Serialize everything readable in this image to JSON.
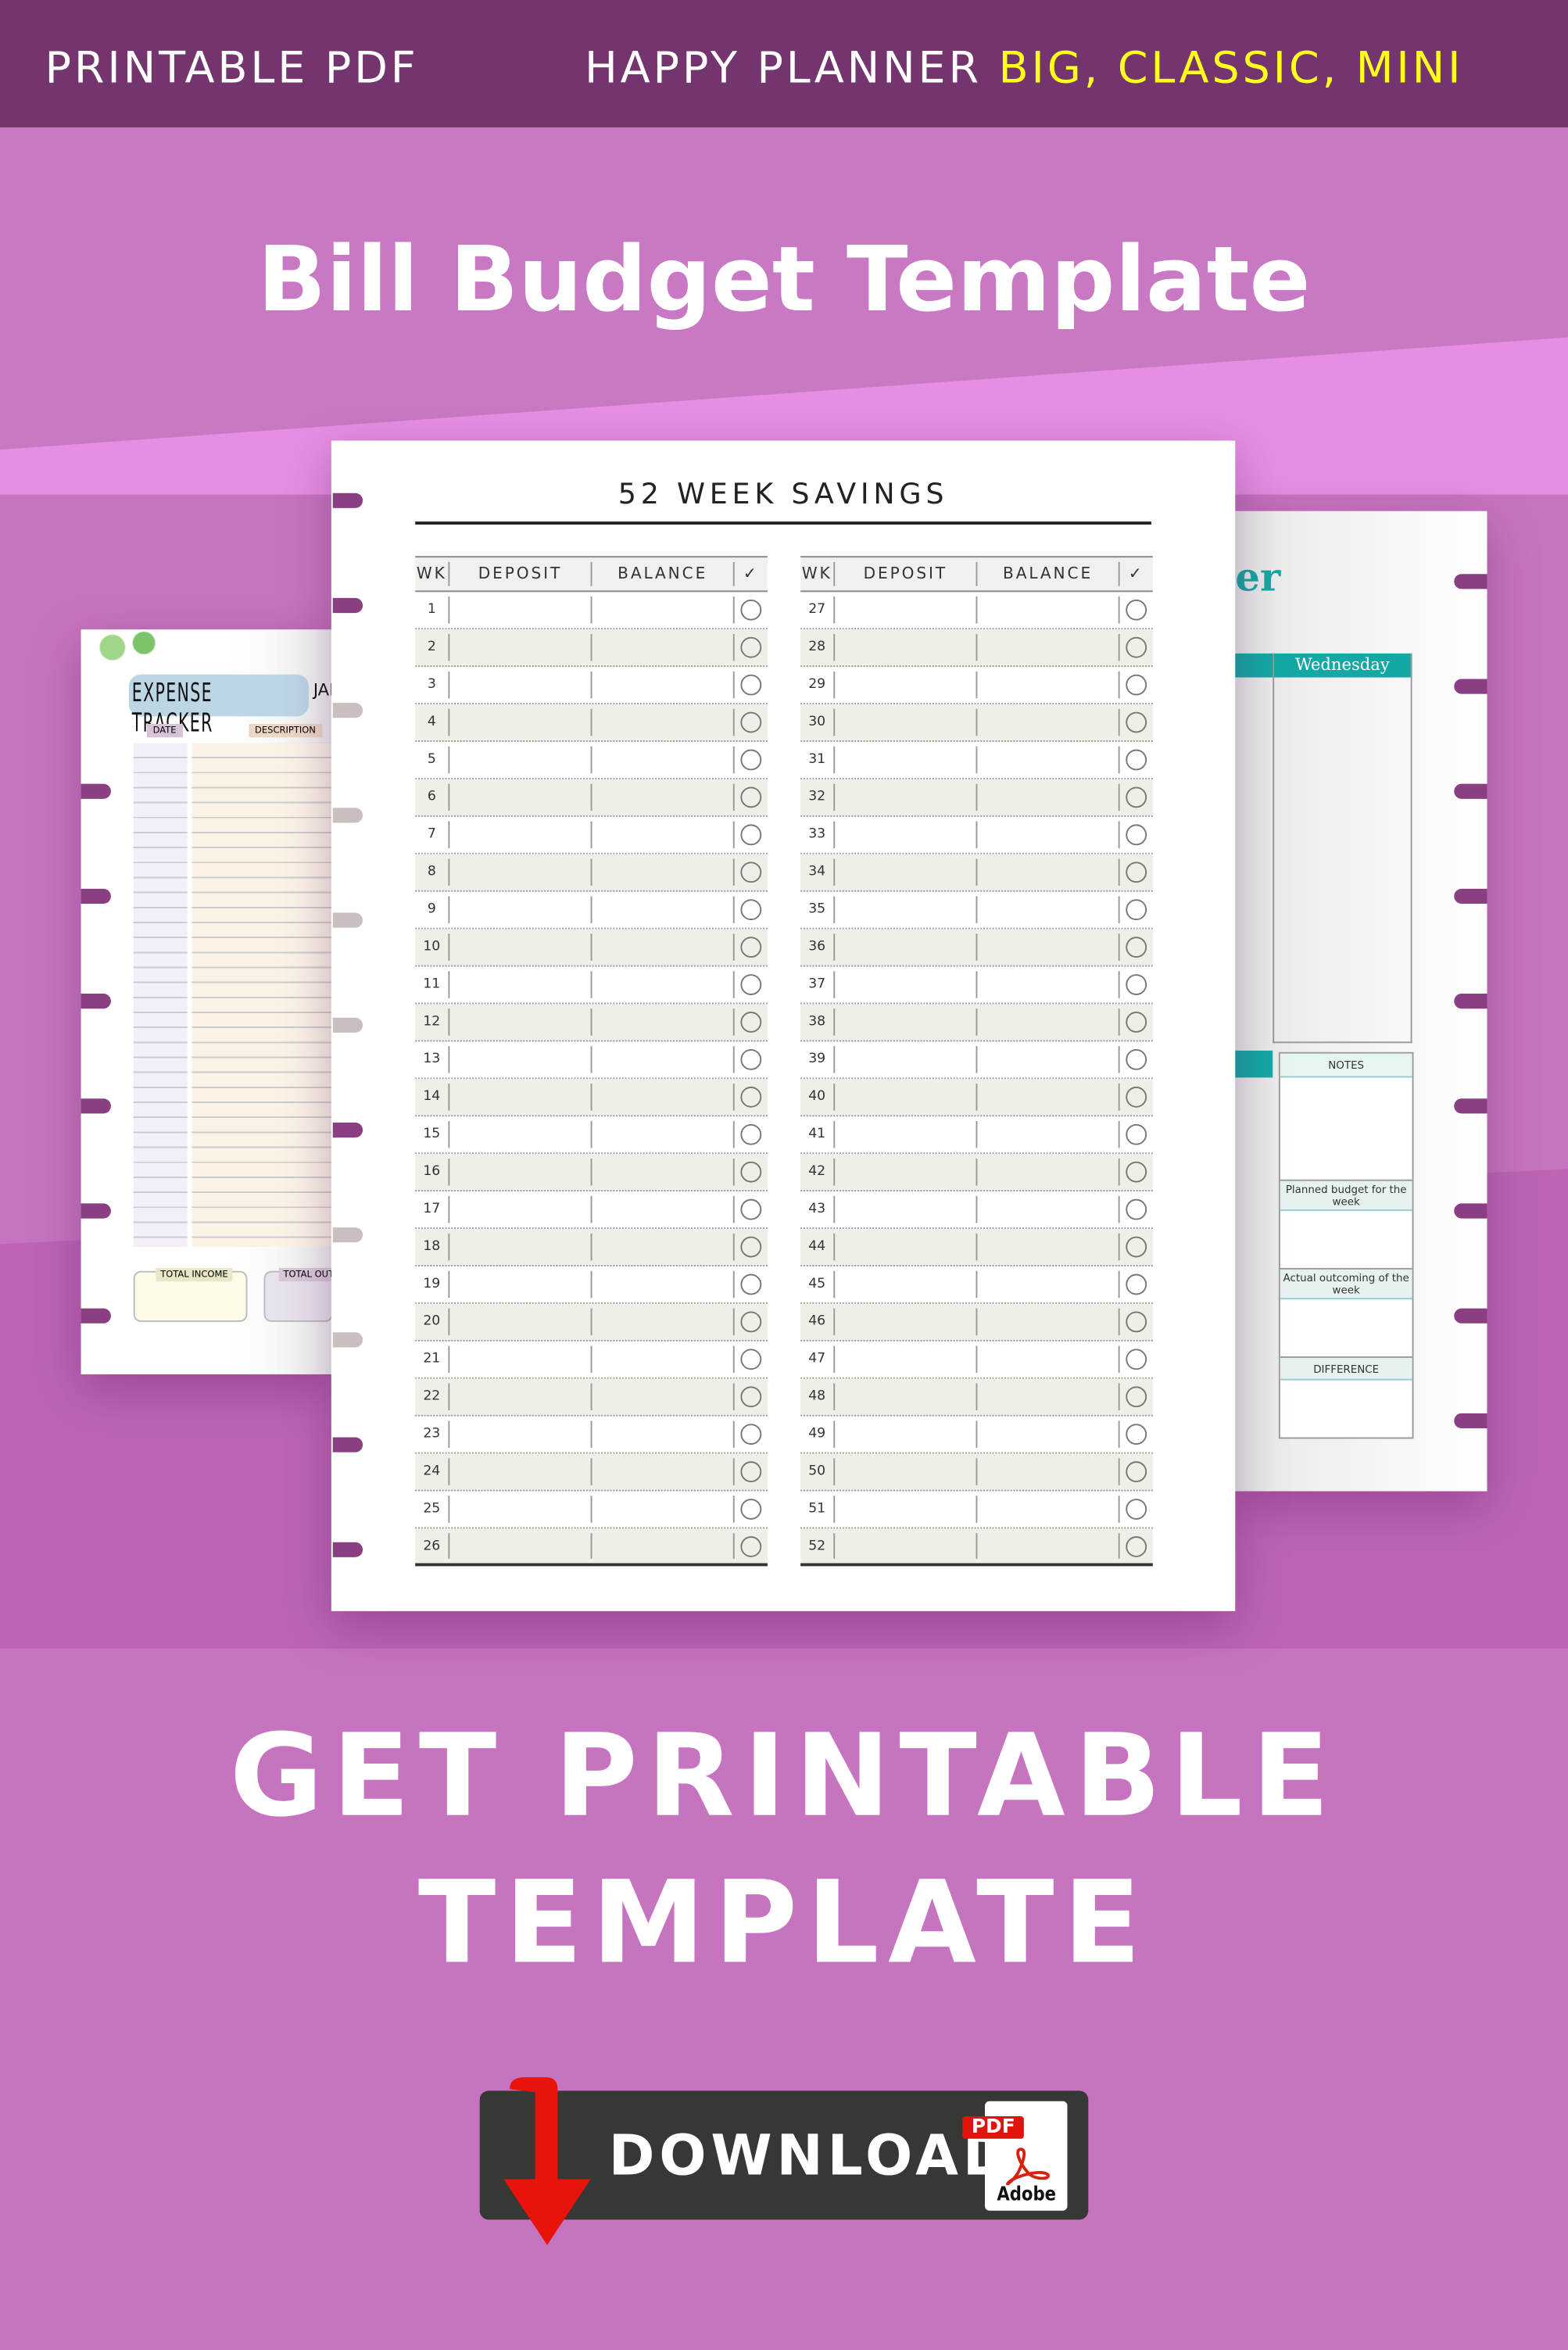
{
  "header": {
    "left": "PRINTABLE PDF",
    "right_white": "HAPPY PLANNER",
    "right_yellow": "BIG, CLASSIC, MINI"
  },
  "title": "Bill Budget Template",
  "colors": {
    "header": "#74356f",
    "background": "#c774c0",
    "accent_yellow": "#ffff1a",
    "binding": "#8a3f83",
    "teal": "#14a8a4",
    "button": "#363836",
    "arrow": "#e8140c"
  },
  "savings_page": {
    "title": "52 WEEK SAVINGS",
    "columns": [
      "WK",
      "DEPOSIT",
      "BALANCE",
      "✓"
    ],
    "weeks_left": [
      1,
      2,
      3,
      4,
      5,
      6,
      7,
      8,
      9,
      10,
      11,
      12,
      13,
      14,
      15,
      16,
      17,
      18,
      19,
      20,
      21,
      22,
      23,
      24,
      25,
      26
    ],
    "weeks_right": [
      27,
      28,
      29,
      30,
      31,
      32,
      33,
      34,
      35,
      36,
      37,
      38,
      39,
      40,
      41,
      42,
      43,
      44,
      45,
      46,
      47,
      48,
      49,
      50,
      51,
      52
    ]
  },
  "expense_page": {
    "title": "EXPENSE TRACKER",
    "month_fragment": "JAN",
    "date": "DATE",
    "description": "DESCRIPTION",
    "total_income": "TOTAL INCOME",
    "total_out": "TOTAL OUTG"
  },
  "weekly_page": {
    "title_fragment": "er",
    "day": "Wednesday",
    "notes": "NOTES",
    "planned": "Planned budget for the week",
    "actual": "Actual outcoming of the week",
    "difference": "DIFFERENCE"
  },
  "cta": {
    "line1": "GET PRINTABLE",
    "line2": "TEMPLATE"
  },
  "download": {
    "label": "DOWNLOAD",
    "badge": "PDF",
    "brand": "Adobe"
  }
}
